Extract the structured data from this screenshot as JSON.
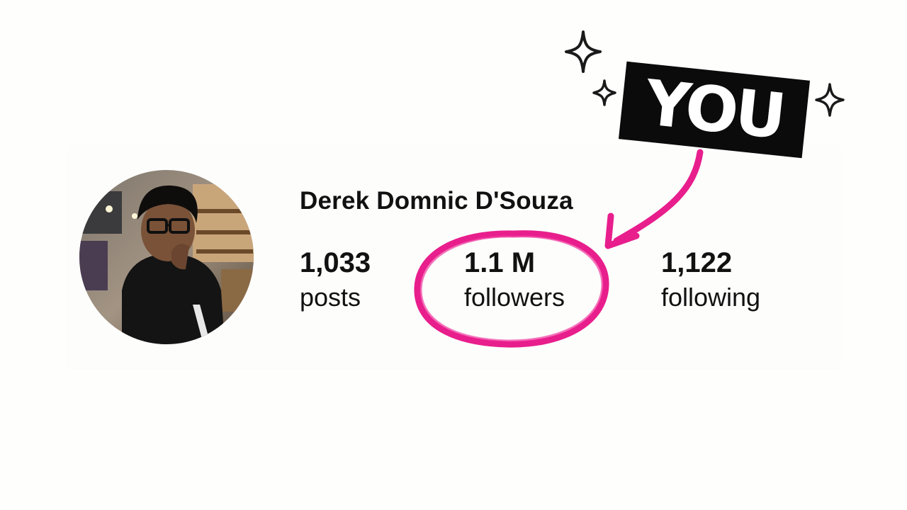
{
  "profile": {
    "name": "Derek Domnic D'Souza",
    "stats": [
      {
        "value": "1,033",
        "label": "posts"
      },
      {
        "value": "1.1 M",
        "label": "followers"
      },
      {
        "value": "1,122",
        "label": "following"
      }
    ]
  },
  "annotation": {
    "label": "YOU",
    "accent_color": "#e81e8c",
    "label_background": "#0b0b0b",
    "label_text_color": "#ffffff",
    "sparkle_icon": "sparkle-icon"
  }
}
